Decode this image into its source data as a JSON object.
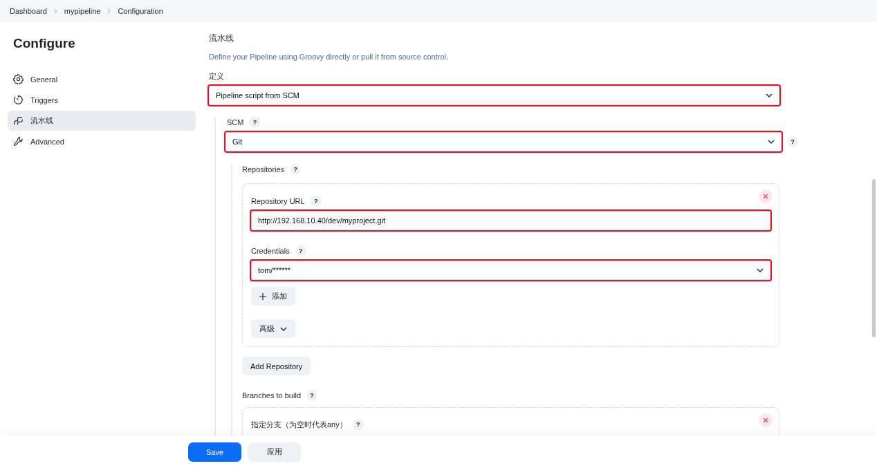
{
  "breadcrumb": [
    {
      "label": "Dashboard"
    },
    {
      "label": "mypipeline"
    },
    {
      "label": "Configuration"
    }
  ],
  "sidebar": {
    "title": "Configure",
    "items": [
      {
        "label": "General",
        "kind": "gear",
        "selected": false
      },
      {
        "label": "Triggers",
        "kind": "timer",
        "selected": false
      },
      {
        "label": "流水线",
        "kind": "pipeline",
        "selected": true
      },
      {
        "label": "Advanced",
        "kind": "wrench",
        "selected": false
      }
    ]
  },
  "section": {
    "title": "流水线",
    "description": "Define your Pipeline using Groovy directly or pull it from source control.",
    "definition": {
      "label": "定义",
      "kind": "select",
      "value": "Pipeline script from SCM",
      "highlighted": true
    },
    "scm": {
      "label": "SCM",
      "help": "?",
      "kind": "select",
      "value": "Git",
      "highlighted": true,
      "side_help": "?"
    },
    "repositories": {
      "label": "Repositories",
      "help": "?",
      "items": [
        {
          "url": {
            "label": "Repository URL",
            "help": "?",
            "kind": "text",
            "value": "http://192.168.10.40/dev/myproject.git",
            "highlighted": true
          },
          "credentials": {
            "label": "Credentials",
            "help": "?",
            "kind": "select",
            "value": "tom/******",
            "highlighted": true
          },
          "add_button": "添加",
          "advanced_button": "高级"
        }
      ],
      "add_button": "Add Repository"
    },
    "branches": {
      "label": "Branches to build",
      "help": "?",
      "items": [
        {
          "label": "指定分支（为空时代表any）",
          "help": "?"
        }
      ]
    }
  },
  "footer": {
    "buttons": [
      {
        "label": "Save",
        "kind": "primary"
      },
      {
        "label": "应用",
        "kind": "secondary"
      }
    ]
  }
}
